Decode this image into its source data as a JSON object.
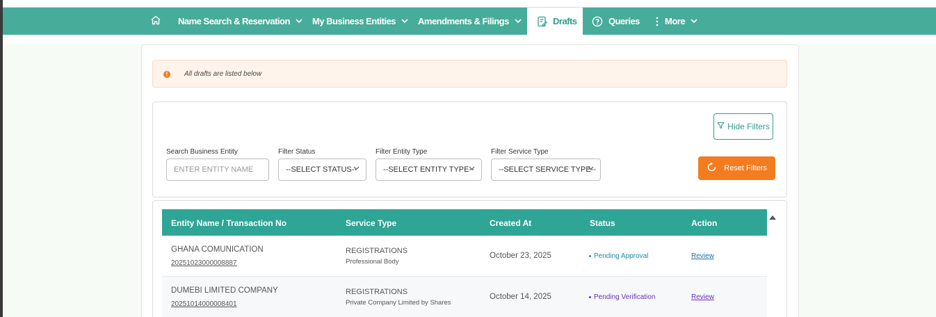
{
  "nav": {
    "home_icon": "home-icon",
    "items": [
      {
        "label": "Name Search & Reservation",
        "has_chevron": true
      },
      {
        "label": "My Business Entities",
        "has_chevron": true
      },
      {
        "label": "Amendments & Filings",
        "has_chevron": true
      },
      {
        "label": "Drafts",
        "active": true,
        "icon": "draft-icon"
      },
      {
        "label": "Queries",
        "icon": "question-circle-icon"
      },
      {
        "label": "More",
        "has_chevron": true,
        "icon": "kebab-icon"
      }
    ]
  },
  "alert": {
    "text": "All drafts are listed below",
    "icon": "exclamation-icon",
    "color": "#f47c20"
  },
  "filters": {
    "hide_label": "Hide Filters",
    "search": {
      "label": "Search Business Entity",
      "placeholder": "ENTER ENTITY NAME"
    },
    "status": {
      "label": "Filter Status",
      "value": "--SELECT STATUS--"
    },
    "entity_type": {
      "label": "Filter Entity Type",
      "value": "--SELECT ENTITY TYPE--"
    },
    "service_type": {
      "label": "Filter Service Type",
      "value": "--SELECT SERVICE TYPE--"
    },
    "reset_label": "Reset Filters"
  },
  "table": {
    "headers": [
      "Entity Name / Transaction No",
      "Service Type",
      "Created At",
      "Status",
      "Action"
    ],
    "rows": [
      {
        "entity_name": "GHANA COMUNICATION",
        "transaction_no": "20251023000008887",
        "service_type": "REGISTRATIONS",
        "service_sub": "Professional Body",
        "created_at": "October 23, 2025",
        "status": "Pending Approval",
        "status_color": "#1f8aa6",
        "action": "Review",
        "action_color": "#1f6fa6"
      },
      {
        "entity_name": "DUMEBI LIMITED COMPANY",
        "transaction_no": "20251014000008401",
        "service_type": "REGISTRATIONS",
        "service_sub": "Private Company Limited by Shares",
        "created_at": "October 14, 2025",
        "status": "Pending Verification",
        "status_color": "#6a2fc2",
        "action": "Review",
        "action_color": "#6a2fc2"
      }
    ]
  },
  "colors": {
    "brand": "#48ac9b",
    "table_header": "#2fa595",
    "accent_orange": "#f47c20"
  }
}
